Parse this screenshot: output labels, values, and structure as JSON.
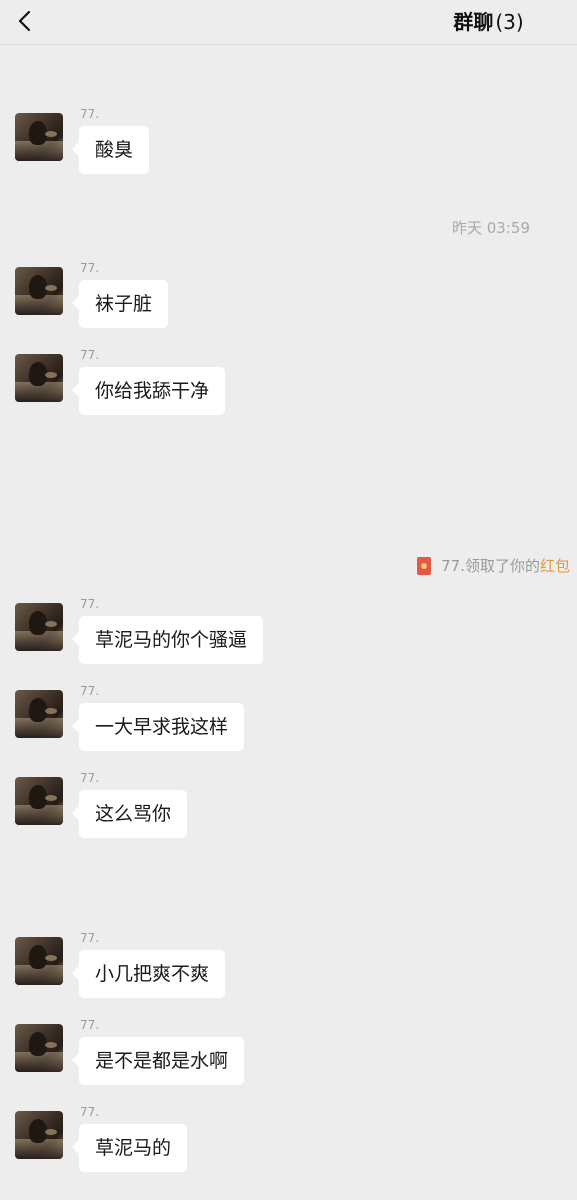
{
  "header": {
    "back_icon": "chevron-left-icon",
    "title": "群聊",
    "member_count": "(3)"
  },
  "timestamp": "昨天 03:59",
  "system_notice": {
    "icon": "red-packet-icon",
    "text": "77.领取了你的",
    "link": "红包",
    "link_color": "#e39a3b"
  },
  "messages": [
    {
      "sender": "77.",
      "text": "酸臭"
    },
    {
      "sender": "77.",
      "text": "袜子脏"
    },
    {
      "sender": "77.",
      "text": "你给我舔干净"
    },
    {
      "sender": "77.",
      "text": "草泥马的你个骚逼"
    },
    {
      "sender": "77.",
      "text": "一大早求我这样"
    },
    {
      "sender": "77.",
      "text": "这么骂你"
    },
    {
      "sender": "77.",
      "text": "小几把爽不爽"
    },
    {
      "sender": "77.",
      "text": "是不是都是水啊"
    },
    {
      "sender": "77.",
      "text": "草泥马的"
    }
  ]
}
